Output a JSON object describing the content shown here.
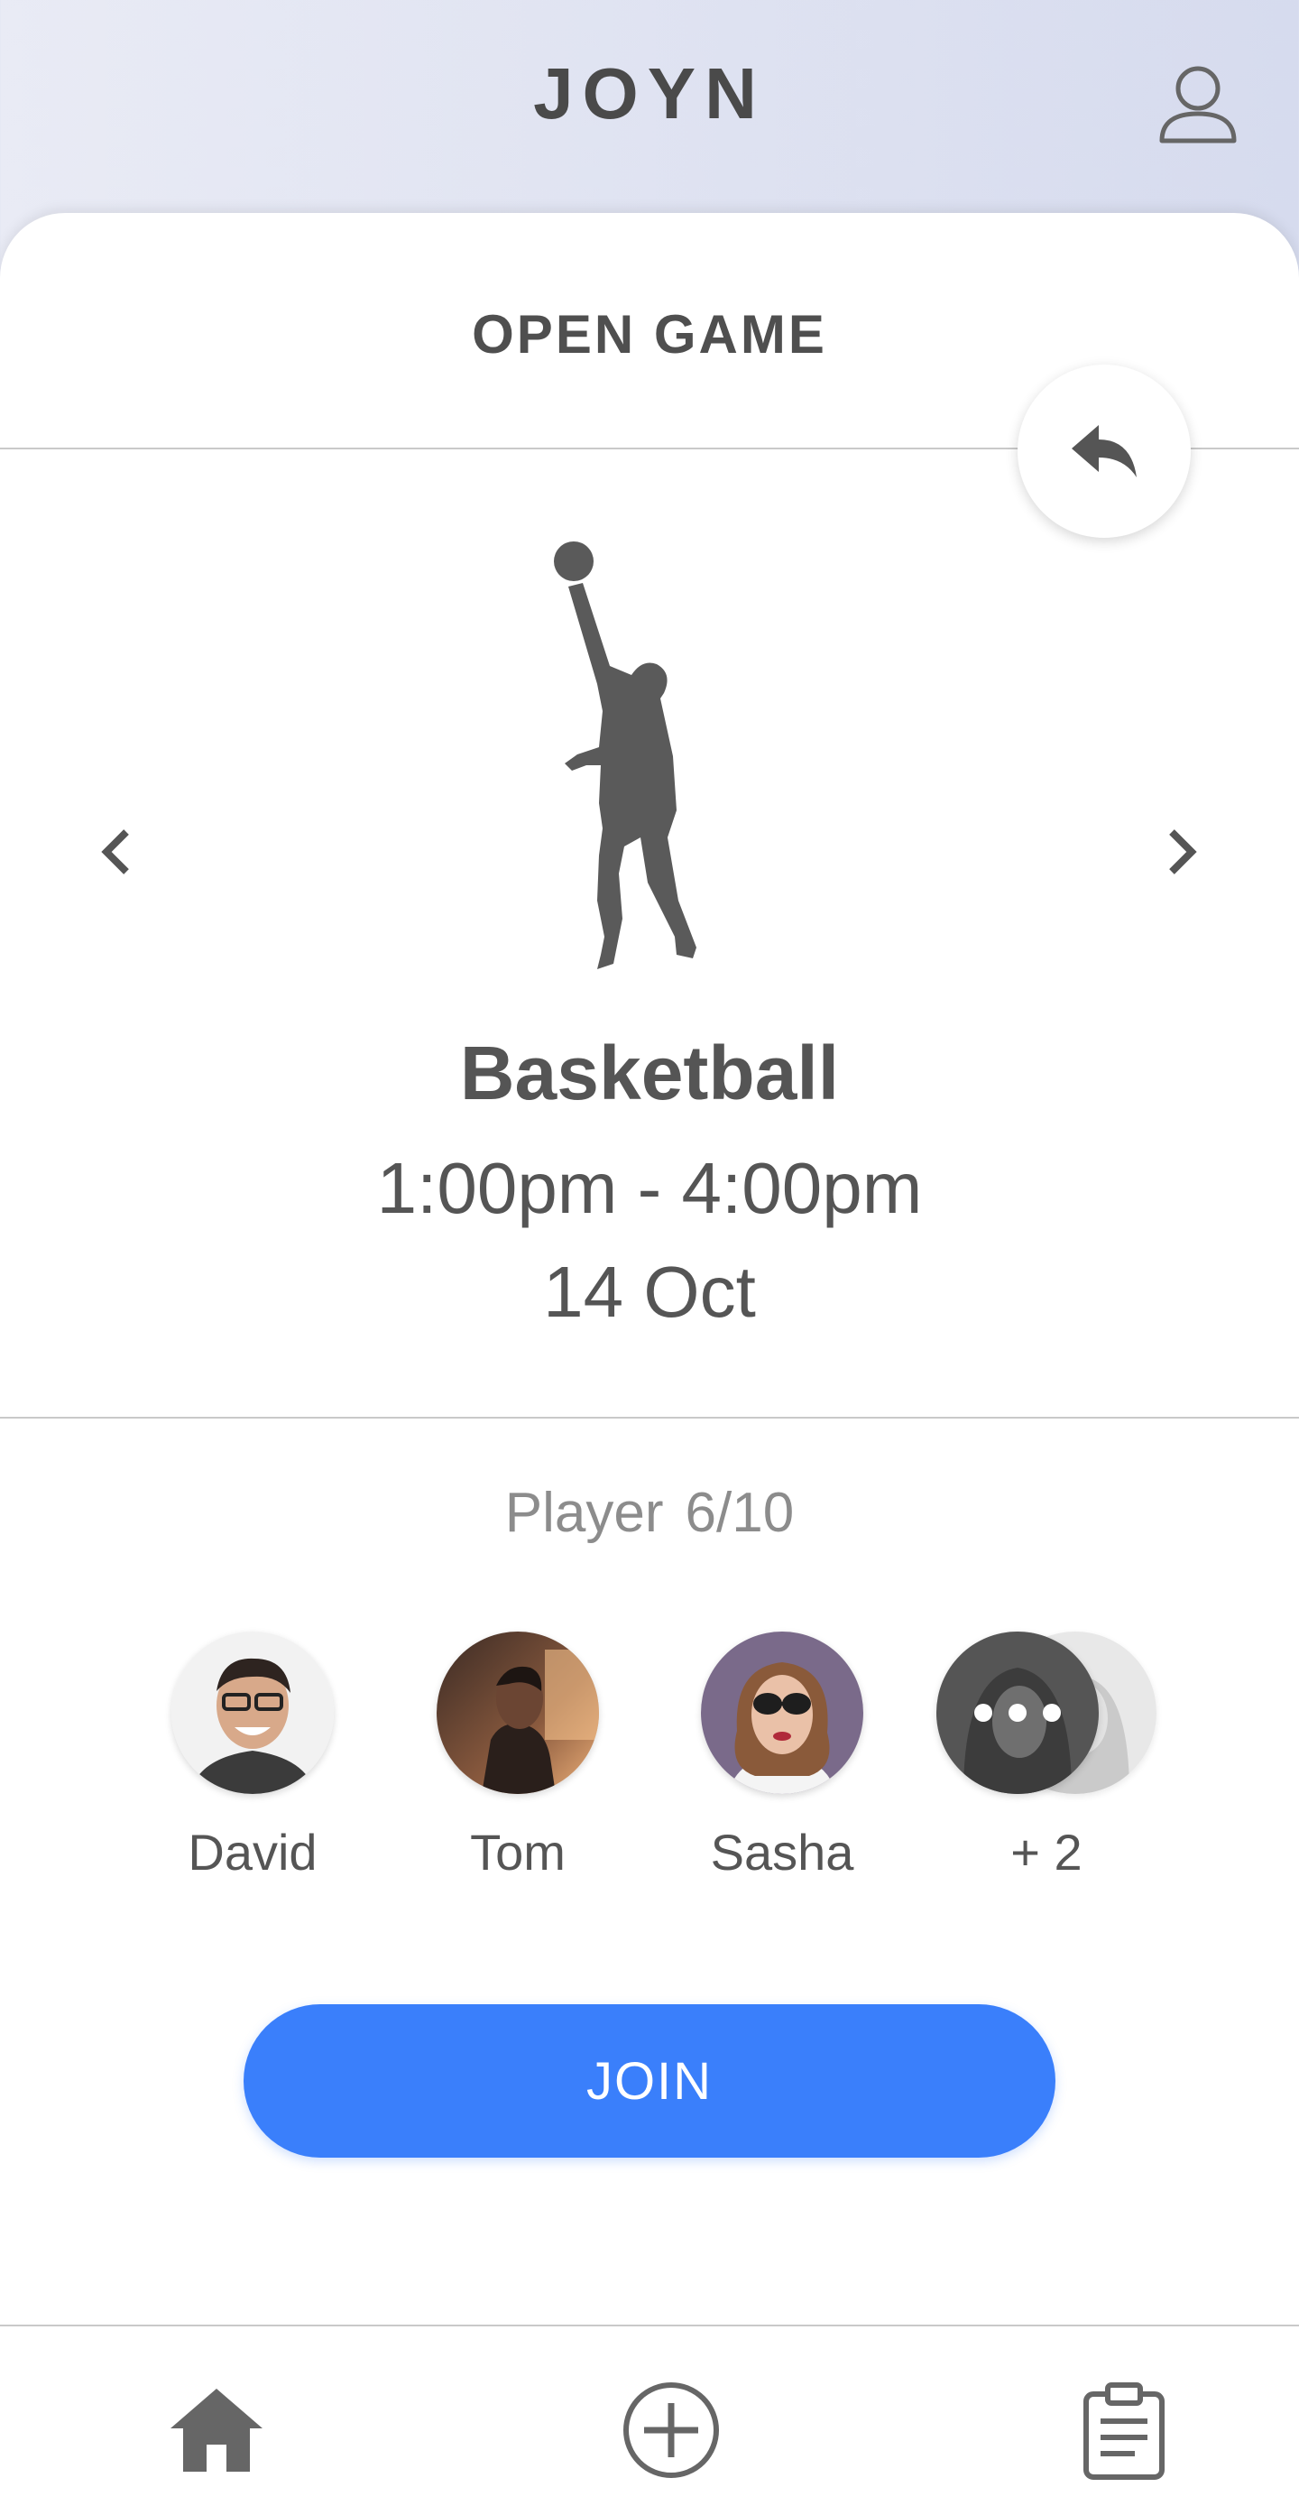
{
  "header": {
    "app_title": "JOYN",
    "profile_icon": "user-icon"
  },
  "card": {
    "title": "OPEN GAME",
    "back_icon": "reply-arrow-icon",
    "prev_icon": "chevron-left-icon",
    "next_icon": "chevron-right-icon",
    "sport": {
      "name": "Basketball",
      "time": "1:00pm - 4:00pm",
      "date": "14 Oct",
      "icon": "basketball-player-icon"
    },
    "players": {
      "label": "Player",
      "count": "6/10",
      "list": [
        {
          "name": "David"
        },
        {
          "name": "Tom"
        },
        {
          "name": "Sasha"
        },
        {
          "name": "+ 2"
        }
      ]
    },
    "join_label": "JOIN"
  },
  "bottom_nav": [
    {
      "icon": "home-icon"
    },
    {
      "icon": "add-circle-icon"
    },
    {
      "icon": "clipboard-icon"
    }
  ],
  "colors": {
    "accent": "#3a7ffb",
    "text": "#555555",
    "muted": "#8c8c8c"
  }
}
